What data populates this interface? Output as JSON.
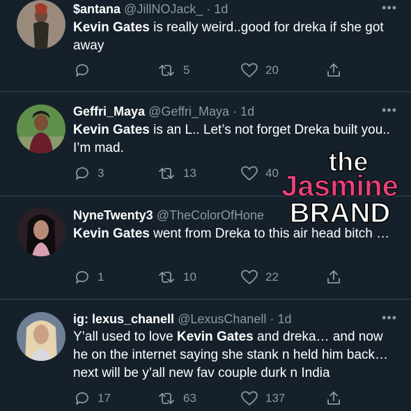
{
  "colors": {
    "background": "#15202b",
    "divider": "#38444d",
    "secondary_text": "#8b98a5",
    "watermark_pink": "#e8417a"
  },
  "icons": {
    "reply": "reply-icon",
    "retweet": "retweet-icon",
    "like": "heart-icon",
    "share": "share-icon",
    "more": "more-icon"
  },
  "tweets": [
    {
      "name": "$antana",
      "handle": "@JillNOJack_",
      "time": "· 1d",
      "bold": "Kevin Gates",
      "body": " is really weird..good for dreka if she got away",
      "replies": "",
      "retweets": "5",
      "likes": "20"
    },
    {
      "name": "Geffri_Maya",
      "handle": "@Geffri_Maya",
      "time": "· 1d",
      "bold": "Kevin Gates",
      "body": " is an L.. Let’s not forget Dreka built you.. I’m mad.",
      "replies": "3",
      "retweets": "13",
      "likes": "40"
    },
    {
      "name": "NyneTwenty3",
      "handle": "@TheColorOfHone",
      "time": "",
      "bold": "Kevin Gates",
      "body": " went from Dreka to this air head bitch …",
      "replies": "1",
      "retweets": "10",
      "likes": "22"
    },
    {
      "name": "ig: lexus_chanell",
      "handle": "@LexusChanell",
      "time": "· 1d",
      "pre": "Y’all used to love ",
      "bold": "Kevin Gates",
      "body": " and dreka… and now he on the internet saying she stank n held him back… next will be y’all new fav couple durk n India",
      "replies": "17",
      "retweets": "63",
      "likes": "137"
    }
  ],
  "watermark": {
    "line1": "the",
    "line2": "Jasmine",
    "line3": "BRAND"
  }
}
